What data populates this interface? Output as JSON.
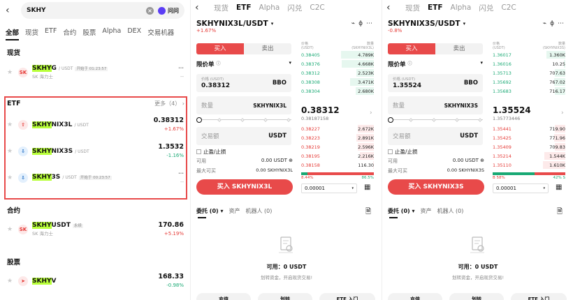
{
  "search": {
    "query": "SKHY",
    "ask_label": "问问"
  },
  "categories": [
    "全部",
    "现货",
    "ETF",
    "合约",
    "股票",
    "Alpha",
    "DEX",
    "交易机器"
  ],
  "sections": {
    "spot": "现货",
    "etf": "ETF",
    "futures": "合约",
    "stocks": "股票",
    "etf_more": "更多（4）"
  },
  "spot_rows": [
    {
      "hl": "SKHY",
      "rest": "G",
      "quote": "/ USDT",
      "tag": "开始于 01:23:57",
      "sub": "SK 海力士",
      "price": "--",
      "chg": "--"
    }
  ],
  "etf_rows": [
    {
      "hl": "SKHY",
      "rest": "NIX3L",
      "quote": "/ USDT",
      "tag": "",
      "sub": "",
      "price": "0.38312",
      "chg": "+1.67%"
    },
    {
      "hl": "SKHY",
      "rest": "NIX3S",
      "quote": "/ USDT",
      "tag": "",
      "sub": "",
      "price": "1.3532",
      "chg": "-1.16%"
    },
    {
      "hl": "SKHY",
      "rest": "3S",
      "quote": "/ USDT",
      "tag": "开始于 00:23:57",
      "sub": "",
      "price": "--",
      "chg": "--"
    }
  ],
  "futures_rows": [
    {
      "hl": "SKHY",
      "rest": "USDT",
      "quote": "",
      "tag": "永续",
      "sub": "SK 海力士",
      "price": "170.86",
      "chg": "+5.19%"
    }
  ],
  "stock_rows": [
    {
      "hl": "SKHY",
      "rest": "V",
      "quote": "",
      "tag": "",
      "sub": "",
      "price": "168.33",
      "chg": "-0.98%"
    }
  ],
  "nav_tabs": [
    "现货",
    "ETF",
    "Alpha",
    "闪兑",
    "C2C"
  ],
  "trade_common": {
    "buy": "买入",
    "sell": "卖出",
    "limit": "限价单",
    "price_label": "价格 (USDT)",
    "price_unit": "BBO",
    "qty": "数量",
    "amount": "交易额",
    "usdt": "USDT",
    "tpsl": "止盈/止损",
    "avail": "可用",
    "max_buy": "最大可买",
    "ob_price": "价格",
    "ob_price_unit": "(USDT)",
    "ob_qty": "数量",
    "depth": "0.00001",
    "orders": "委托 (0)",
    "assets": "资产",
    "bots": "机器人 (0)",
    "empty_avail": "可用：0 USDT",
    "empty_tip": "划转资金，开启现货交易!",
    "btn_deposit": "充值",
    "btn_transfer": "划转",
    "btn_etf": "ETF 入门"
  },
  "trade_a": {
    "pair": "SKHYNIX3L/USDT",
    "chg": "+1.67%",
    "price": "0.38312",
    "unit": "SKHYNIX3L",
    "avail_v": "0.00 USDT ⊕",
    "max_v": "0.00 SKHYNIX3L",
    "buy_btn": "买入 SKHYNIX3L",
    "ob_qty_unit": "(SKHYNIX3L)",
    "asks": [
      [
        "0.38405",
        "4.789K",
        0.45
      ],
      [
        "0.38376",
        "4.668K",
        0.44
      ],
      [
        "0.38312",
        "2.523K",
        0.24
      ],
      [
        "0.38308",
        "3.471K",
        0.33
      ],
      [
        "0.38304",
        "2.680K",
        0.25
      ]
    ],
    "mid": "0.38312",
    "mid_sub": "0.38187158",
    "bids": [
      [
        "0.38227",
        "2.672K",
        0.22
      ],
      [
        "0.38223",
        "2.891K",
        0.24
      ],
      [
        "0.38219",
        "2.596K",
        0.22
      ],
      [
        "0.38195",
        "2.216K",
        0.19
      ],
      [
        "0.38158",
        "116.30",
        0.01
      ]
    ],
    "buy_ratio": 0.084,
    "ratio_l": "8.44%",
    "ratio_r": "86.5%"
  },
  "trade_b": {
    "pair": "SKHYNIX3S/USDT",
    "chg": "-0.8%",
    "price": "1.35524",
    "unit": "SKHYNIX3S",
    "avail_v": "0.00 USDT ⊕",
    "max_v": "0.00 SKHYNIX3S",
    "buy_btn": "买入 SKHYNIX3S",
    "ob_qty_unit": "(SKHYNIX3S)",
    "asks": [
      [
        "1.36017",
        "1.360K",
        0.26
      ],
      [
        "1.36016",
        "10.25",
        0.02
      ],
      [
        "1.35713",
        "707.63",
        0.14
      ],
      [
        "1.35692",
        "767.02",
        0.15
      ],
      [
        "1.35683",
        "716.17",
        0.14
      ]
    ],
    "mid": "1.35524",
    "mid_sub": "1.35773446",
    "bids": [
      [
        "1.35441",
        "719.90",
        0.14
      ],
      [
        "1.35425",
        "771.96",
        0.15
      ],
      [
        "1.35409",
        "709.83",
        0.14
      ],
      [
        "1.35214",
        "1.544K",
        0.29
      ],
      [
        "1.35110",
        "1.610K",
        0.31
      ]
    ],
    "buy_ratio": 0.58,
    "ratio_l": "B 58%",
    "ratio_r": "42% S"
  },
  "colors": {
    "accent": "#e84a4a",
    "up": "#e53935",
    "down": "#19a974",
    "highlight": "#b8ff3a"
  }
}
